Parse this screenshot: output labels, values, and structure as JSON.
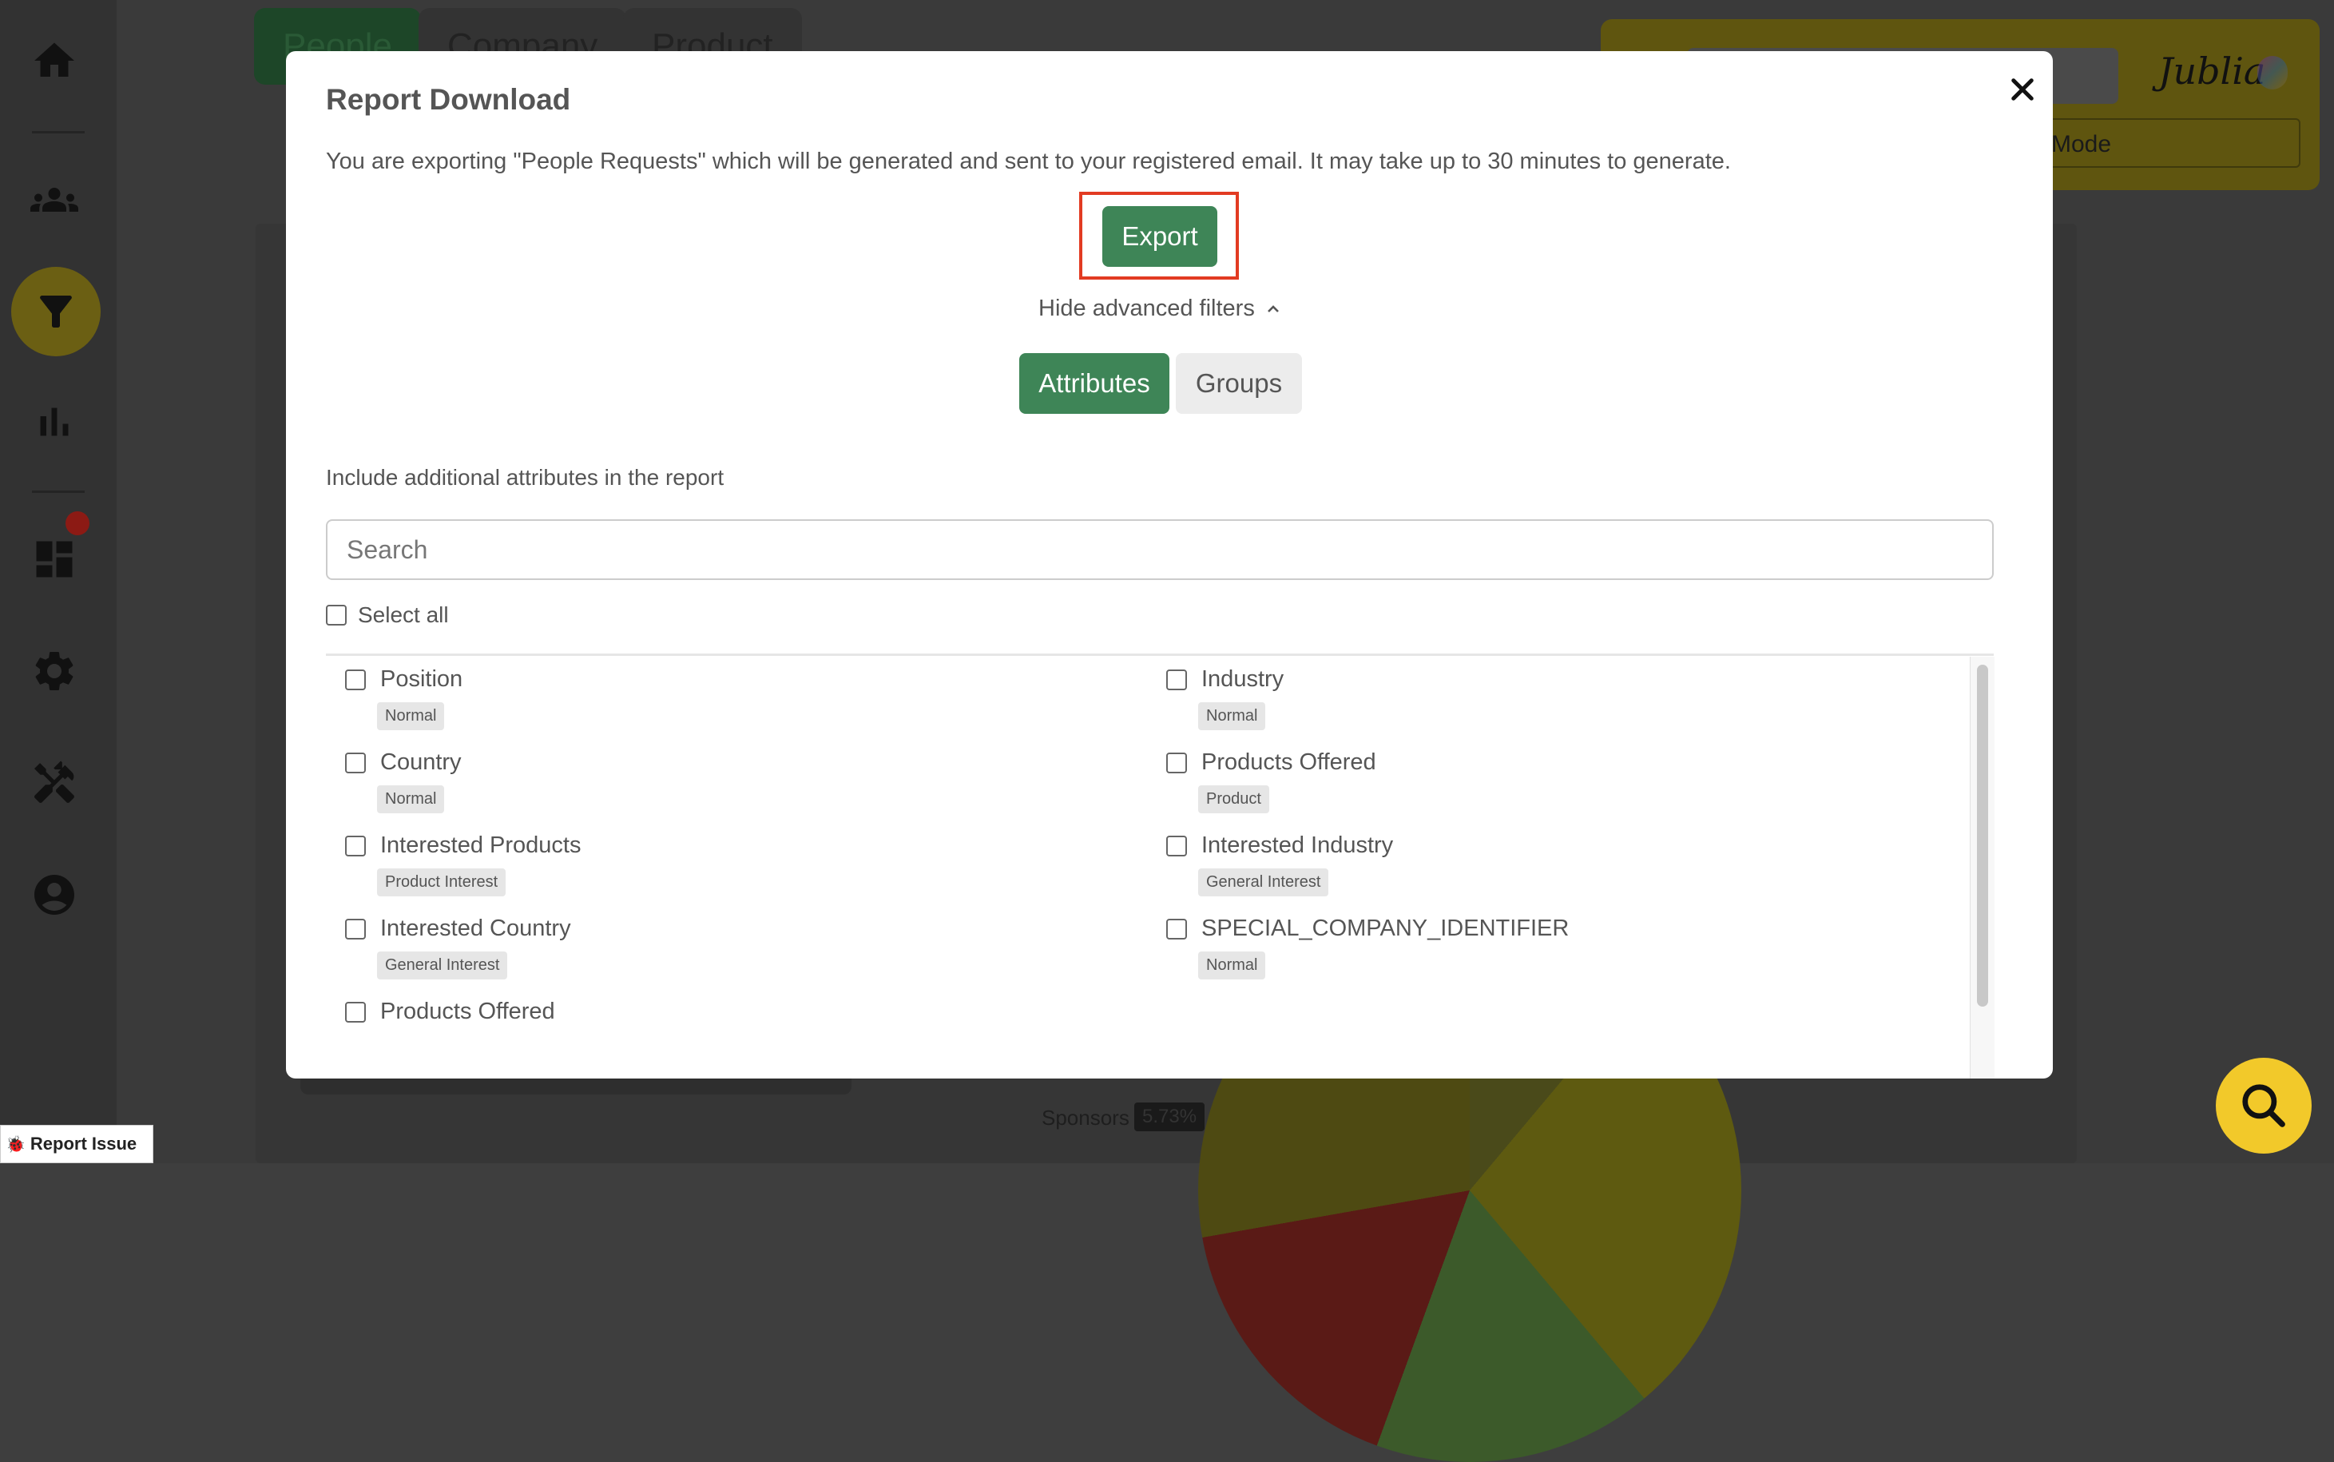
{
  "background": {
    "tabs": [
      "People",
      "Company",
      "Product"
    ],
    "mode_label": "Mode",
    "logo_text": "Jublia",
    "sponsors_label": "Sponsors",
    "sponsors_value": "5.73%",
    "sidebar_icons": [
      "home-icon",
      "people-icon",
      "filter-icon",
      "bar-chart-icon",
      "dashboard-icon",
      "settings-icon",
      "tools-icon",
      "account-icon"
    ]
  },
  "report_issue": {
    "label": "Report Issue"
  },
  "modal": {
    "title": "Report Download",
    "description": "You are exporting \"People Requests\" which will be generated and sent to your registered email. It may take up to 30 minutes to generate.",
    "export_label": "Export",
    "hide_filters_label": "Hide advanced filters",
    "tabs": {
      "attributes": "Attributes",
      "groups": "Groups"
    },
    "include_label": "Include additional attributes in the report",
    "search_placeholder": "Search",
    "select_all_label": "Select all",
    "attributes": [
      {
        "label": "Position",
        "badge": "Normal"
      },
      {
        "label": "Industry",
        "badge": "Normal"
      },
      {
        "label": "Country",
        "badge": "Normal"
      },
      {
        "label": "Products Offered",
        "badge": "Product"
      },
      {
        "label": "Interested Products",
        "badge": "Product Interest"
      },
      {
        "label": "Interested Industry",
        "badge": "General Interest"
      },
      {
        "label": "Interested Country",
        "badge": "General Interest"
      },
      {
        "label": "SPECIAL_COMPANY_IDENTIFIER",
        "badge": "Normal"
      },
      {
        "label": "Products Offered",
        "badge": ""
      }
    ]
  },
  "colors": {
    "accent_green": "#3e8557",
    "highlight_red": "#e23b22",
    "fab_yellow": "#f2c92a"
  }
}
